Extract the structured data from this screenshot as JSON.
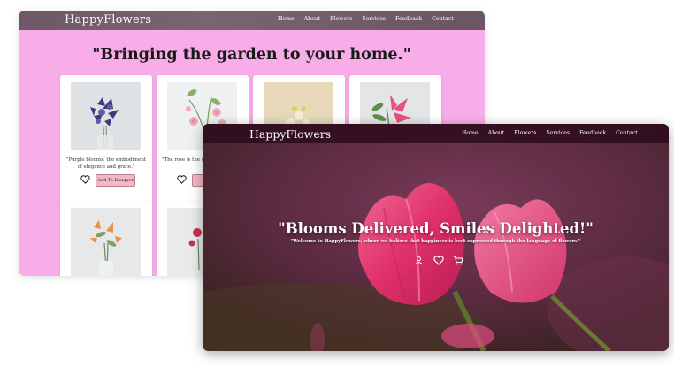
{
  "back_page": {
    "brand": "HappyFlowers",
    "nav": [
      "Home",
      "About",
      "Flowers",
      "Services",
      "Feedback",
      "Contact"
    ],
    "headline": "\"Bringing the garden to your home.\"",
    "cards": [
      {
        "caption": "\"Purple blooms: the embodiment of elegance and grace.\"",
        "button": "Add To Bouquet",
        "icon": "heart-icon"
      },
      {
        "caption": "\"The rose is the of love and d",
        "button": "Ad",
        "icon": "heart-icon"
      }
    ]
  },
  "front_page": {
    "brand": "HappyFlowers",
    "nav": [
      "Home",
      "About",
      "Flowers",
      "Services",
      "Feedback",
      "Contact"
    ],
    "hero_title": "\"Blooms Delivered, Smiles Delighted!\"",
    "hero_subtitle": "\"Welcome to HappyFlowers, where we believe that happiness is best expressed through the language of flowers.\"",
    "hero_icons": [
      "user-icon",
      "heart-icon",
      "cart-icon"
    ]
  },
  "colors": {
    "back_background": "#f9ade8",
    "nav_bar": "#6d5868",
    "button_pink": "#f5b7c4",
    "tulip_pink": "#e8386e"
  }
}
